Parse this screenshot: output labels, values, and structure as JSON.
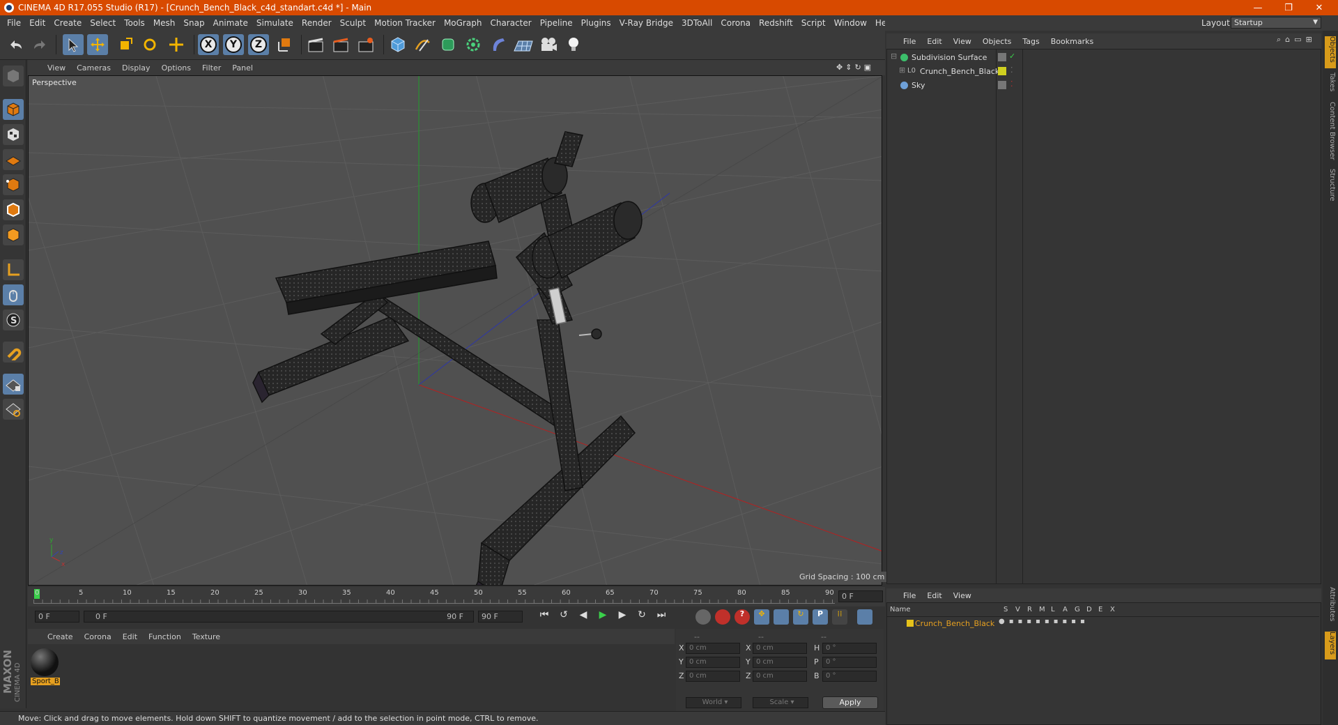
{
  "window": {
    "title": "CINEMA 4D R17.055 Studio (R17) - [Crunch_Bench_Black_c4d_standart.c4d *] - Main",
    "minimize": "—",
    "maximize": "❐",
    "close": "✕"
  },
  "menu": [
    "File",
    "Edit",
    "Create",
    "Select",
    "Tools",
    "Mesh",
    "Snap",
    "Animate",
    "Simulate",
    "Render",
    "Sculpt",
    "Motion Tracker",
    "MoGraph",
    "Character",
    "Pipeline",
    "Plugins",
    "V-Ray Bridge",
    "3DToAll",
    "Corona",
    "Redshift",
    "Script",
    "Window",
    "Help"
  ],
  "layout": {
    "label": "Layout:",
    "value": "Startup"
  },
  "toolbar": {
    "x_axis": "X",
    "y_axis": "Y",
    "z_axis": "Z"
  },
  "viewport": {
    "menu": [
      "View",
      "Cameras",
      "Display",
      "Options",
      "Filter",
      "Panel"
    ],
    "label": "Perspective",
    "grid_spacing": "Grid Spacing : 100 cm",
    "axis_y": "y",
    "axis_z": "z",
    "axis_x": "x"
  },
  "timeline": {
    "ticks": [
      "0",
      "5",
      "10",
      "15",
      "20",
      "25",
      "30",
      "35",
      "40",
      "45",
      "50",
      "55",
      "60",
      "65",
      "70",
      "75",
      "80",
      "85",
      "90"
    ],
    "end_field": "0 F",
    "start_field": "0 F",
    "range_start": "0 F",
    "range_end": "90 F",
    "max_field": "90 F"
  },
  "material_manager": {
    "menu": [
      "Create",
      "Corona",
      "Edit",
      "Function",
      "Texture"
    ],
    "material_name": "Sport_B"
  },
  "coordinates": {
    "header": [
      "--",
      "--",
      "--"
    ],
    "rows": [
      {
        "l1": "X",
        "v1": "0 cm",
        "l2": "X",
        "v2": "0 cm",
        "l3": "H",
        "v3": "0 °"
      },
      {
        "l1": "Y",
        "v1": "0 cm",
        "l2": "Y",
        "v2": "0 cm",
        "l3": "P",
        "v3": "0 °"
      },
      {
        "l1": "Z",
        "v1": "0 cm",
        "l2": "Z",
        "v2": "0 cm",
        "l3": "B",
        "v3": "0 °"
      }
    ],
    "mode": "World",
    "transform": "Scale",
    "apply": "Apply"
  },
  "status": "Move: Click and drag to move elements. Hold down SHIFT to quantize movement / add to the selection in point mode, CTRL to remove.",
  "object_manager": {
    "menu": [
      "File",
      "Edit",
      "View",
      "Objects",
      "Tags",
      "Bookmarks"
    ],
    "objects": [
      {
        "name": "Subdivision Surface",
        "color": "#3cbf6b"
      },
      {
        "name": "Crunch_Bench_Black",
        "color": "#d0d020"
      },
      {
        "name": "Sky",
        "color": "#6ea0d8"
      }
    ]
  },
  "layer_manager": {
    "menu": [
      "File",
      "Edit",
      "View"
    ],
    "columns": [
      "Name",
      "S",
      "V",
      "R",
      "M",
      "L",
      "A",
      "G",
      "D",
      "E",
      "X"
    ],
    "layer_name": "Crunch_Bench_Black",
    "layer_color": "#e6c21a"
  },
  "side_tabs": [
    "Objects",
    "Takes",
    "Content Browser",
    "Structure"
  ],
  "side_tabs_bottom": [
    "Attributes",
    "Layers"
  ],
  "maxon_logo": "MAXON",
  "maxon_sub": "CINEMA 4D",
  "colors": {
    "titlebar": "#d84a00",
    "accent": "#5b7fa8",
    "highlight": "#e6a020"
  }
}
